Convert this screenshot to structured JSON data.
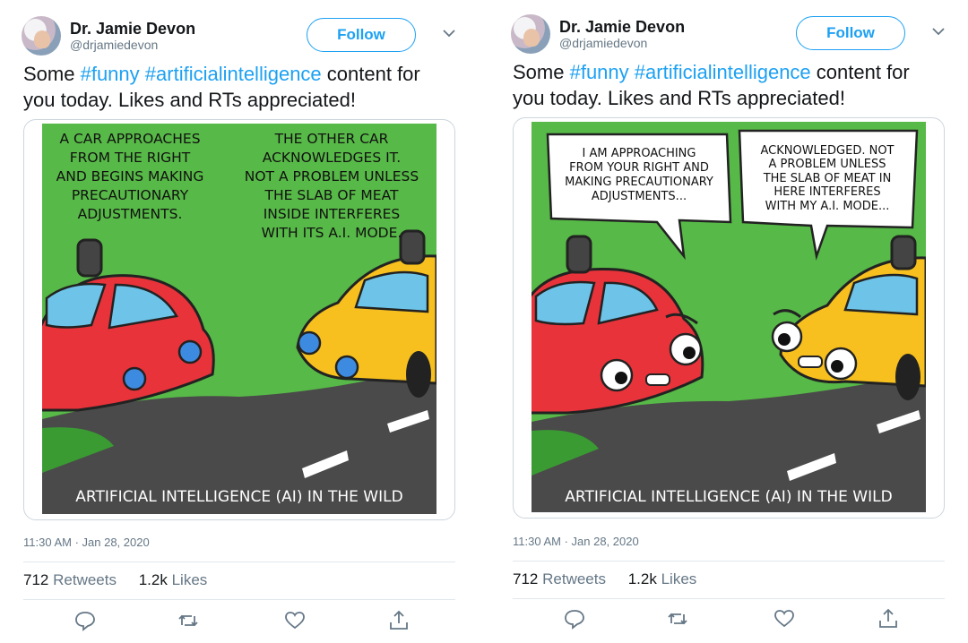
{
  "tweets": [
    {
      "display_name": "Dr. Jamie Devon",
      "handle": "@drjamiedevon",
      "follow_label": "Follow",
      "text_parts": [
        "Some ",
        "#funny",
        " ",
        "#artificialintelligence",
        " content for you today. Likes and RTs appreciated!"
      ],
      "timestamp": "11:30 AM · Jan 28, 2020",
      "retweets": "712",
      "retweets_label": "Retweets",
      "likes": "1.2k",
      "likes_label": "Likes",
      "comic": {
        "left_caption_lines": [
          "A CAR APPROACHES",
          "FROM THE RIGHT",
          "AND BEGINS MAKING",
          "PRECAUTIONARY",
          "ADJUSTMENTS."
        ],
        "right_caption_lines": [
          "THE OTHER CAR",
          "ACKNOWLEDGES IT.",
          "NOT A PROBLEM UNLESS",
          "THE SLAB OF MEAT",
          "INSIDE INTERFERES",
          "WITH ITS A.I. MODE."
        ],
        "footer": "ARTIFICIAL INTELLIGENCE (AI) IN THE WILD"
      }
    },
    {
      "display_name": "Dr. Jamie Devon",
      "handle": "@drjamiedevon",
      "follow_label": "Follow",
      "text_parts": [
        "Some ",
        "#funny",
        " ",
        "#artificialintelligence",
        " content for you today. Likes and RTs appreciated!"
      ],
      "timestamp": "11:30 AM · Jan 28, 2020",
      "retweets": "712",
      "retweets_label": "Retweets",
      "likes": "1.2k",
      "likes_label": "Likes",
      "comic": {
        "left_bubble_lines": [
          "I AM APPROACHING",
          "FROM YOUR RIGHT AND",
          "MAKING PRECAUTIONARY",
          "ADJUSTMENTS..."
        ],
        "right_bubble_lines": [
          "ACKNOWLEDGED. NOT",
          "A PROBLEM UNLESS",
          "THE SLAB OF MEAT IN",
          "HERE INTERFERES",
          "WITH MY A.I. MODE..."
        ],
        "footer": "ARTIFICIAL INTELLIGENCE (AI) IN THE WILD"
      }
    }
  ],
  "colors": {
    "accent": "#1da1f2",
    "sky_green": "#57b947",
    "road": "#4a4a4a",
    "red_car": "#e8333a",
    "yellow_car": "#f7c01e",
    "muted_text": "#657786"
  },
  "icons": [
    "reply-icon",
    "retweet-icon",
    "like-icon",
    "share-icon",
    "chevron-down-icon"
  ]
}
